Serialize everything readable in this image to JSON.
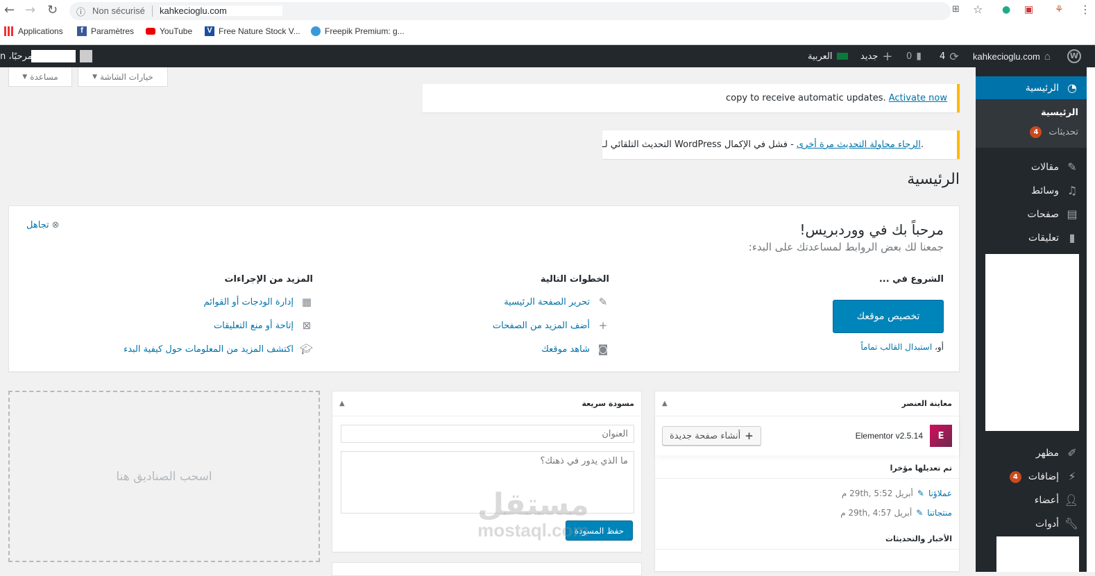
{
  "browser": {
    "security": "Non sécurisé",
    "url": "kahkecioglu.com",
    "bookmarks": [
      {
        "label": "Applications",
        "icon": "apps-grid-icon"
      },
      {
        "label": "Paramètres",
        "icon": "facebook-icon"
      },
      {
        "label": "YouTube",
        "icon": "youtube-icon"
      },
      {
        "label": "Free Nature Stock V...",
        "icon": "videvo-icon"
      },
      {
        "label": "Freepik Premium: g...",
        "icon": "freepik-icon"
      }
    ]
  },
  "adminbar": {
    "site": "kahkecioglu.com",
    "updates": "4",
    "comments": "0",
    "new": "جديد",
    "language": "العربية",
    "greeting": "مرحبًا، n"
  },
  "sidebar": {
    "active": "الرئيسية",
    "submenu": [
      {
        "label": "الرئيسية"
      },
      {
        "label": "تحديثات",
        "badge": "4"
      }
    ],
    "items": [
      {
        "label": "مقالات",
        "icon": "pin-icon"
      },
      {
        "label": "وسائط",
        "icon": "media-icon"
      },
      {
        "label": "صفحات",
        "icon": "pages-icon"
      },
      {
        "label": "تعليقات",
        "icon": "comment-icon"
      }
    ],
    "items2": [
      {
        "label": "مظهر",
        "icon": "brush-icon"
      },
      {
        "label": "إضافات",
        "icon": "plugin-icon",
        "badge": "4"
      },
      {
        "label": "أعضاء",
        "icon": "user-icon"
      },
      {
        "label": "أدوات",
        "icon": "wrench-icon"
      }
    ]
  },
  "screen": {
    "options": "خيارات الشاشة",
    "help": "مساعدة"
  },
  "notices": {
    "n1_text": "copy to receive automatic updates.",
    "n1_link": "Activate now",
    "n2_text": "التحديث التلقائي لـ WordPress فشل في الإكمال - ",
    "n2_link": "الرجاء محاولة التحديث مرة أخرى",
    "n2_end": "."
  },
  "page_title": "الرئيسية",
  "welcome": {
    "title": "مرحباً بك في ووردبريس!",
    "subtitle": "جمعنا لك بعض الروابط لمساعدتك على البدء:",
    "dismiss": "تجاهل",
    "col1": {
      "heading": "الشروع في ...",
      "button": "تخصيص موقعك",
      "or": "أو، ",
      "alt_link": "استبدال القالب تماماً"
    },
    "col2": {
      "heading": "الخطوات التالية",
      "links": [
        "تحرير الصفحة الرئيسية",
        "أضف المزيد من الصفحات",
        "شاهد موقعك"
      ]
    },
    "col3": {
      "heading": "المزيد من الإجراءات",
      "links": [
        "إدارة الودجات أو القوائم",
        "إتاحة أو منع التعليقات",
        "اكتشف المزيد من المعلومات حول كيفية البدء"
      ]
    }
  },
  "elementor": {
    "title": "معاينة العنصر",
    "version": "Elementor v2.5.14",
    "create": "أنشاء صفحة جديدة",
    "recent_heading": "تم تعديلها مؤخرا",
    "recent": [
      {
        "name": "عملاؤنا",
        "date": "أبريل 29th, 5:52 م"
      },
      {
        "name": "منتجاتنا",
        "date": "أبريل 29th, 4:57 م"
      }
    ],
    "news_heading": "الأخبار والتحديثات"
  },
  "quickdraft": {
    "title": "مسودة سريعة",
    "title_placeholder": "العنوان",
    "content_placeholder": "ما الذي يدور في ذهنك؟",
    "save": "حفظ المسودة"
  },
  "dropzone": {
    "label": "اسحب الصناديق هنا"
  },
  "watermark": {
    "arabic": "مستقل",
    "latin": "mostaql.com"
  }
}
